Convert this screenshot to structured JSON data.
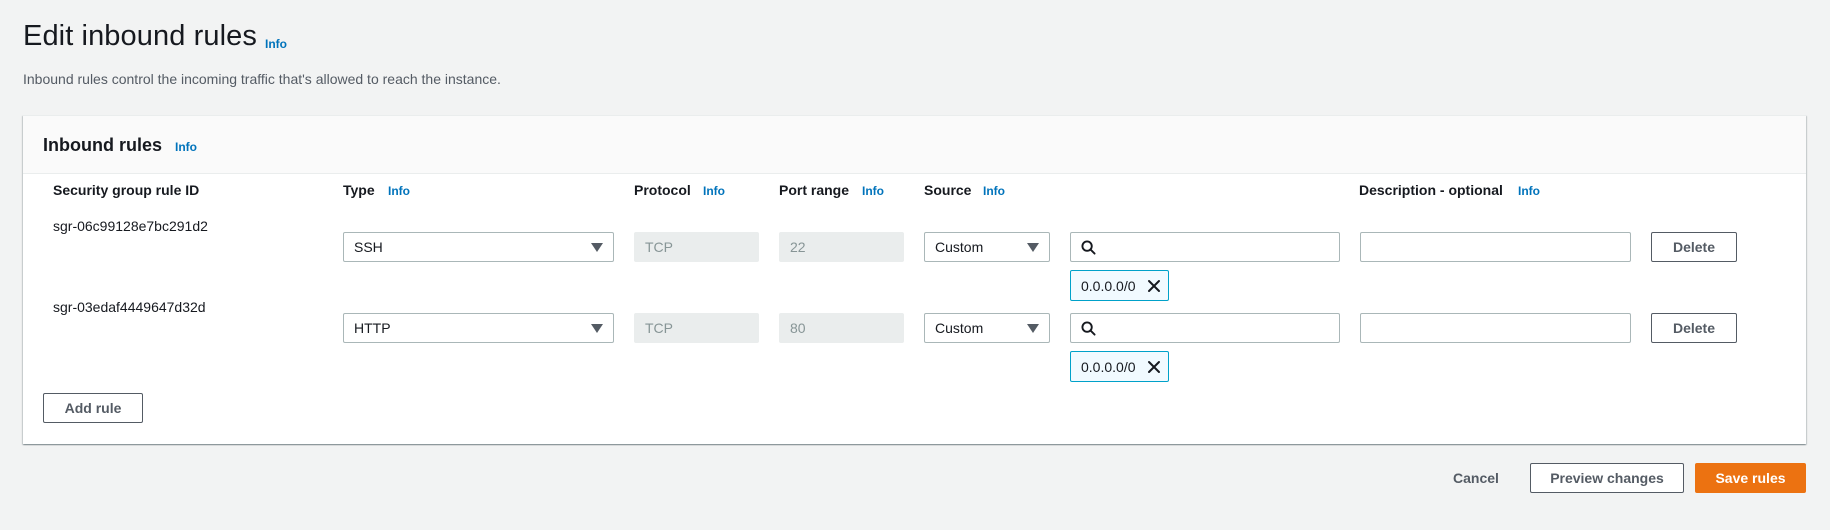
{
  "page": {
    "title": "Edit inbound rules",
    "title_info": "Info",
    "description": "Inbound rules control the incoming traffic that's allowed to reach the instance."
  },
  "panel": {
    "title": "Inbound rules",
    "title_info": "Info",
    "columns": {
      "rule_id": "Security group rule ID",
      "type": "Type",
      "type_info": "Info",
      "protocol": "Protocol",
      "protocol_info": "Info",
      "port_range": "Port range",
      "port_range_info": "Info",
      "source": "Source",
      "source_info": "Info",
      "description": "Description - optional",
      "description_info": "Info"
    },
    "rules": [
      {
        "rule_id": "sgr-06c99128e7bc291d2",
        "type": "SSH",
        "protocol": "TCP",
        "port_range": "22",
        "source": "Custom",
        "search_value": "",
        "token": "0.0.0.0/0",
        "description": "",
        "delete_label": "Delete"
      },
      {
        "rule_id": "sgr-03edaf4449647d32d",
        "type": "HTTP",
        "protocol": "TCP",
        "port_range": "80",
        "source": "Custom",
        "search_value": "",
        "token": "0.0.0.0/0",
        "description": "",
        "delete_label": "Delete"
      }
    ],
    "add_rule_label": "Add rule"
  },
  "footer": {
    "cancel_label": "Cancel",
    "preview_label": "Preview changes",
    "save_label": "Save rules"
  },
  "colors": {
    "primary": "#ec7211",
    "link": "#0073bb",
    "token_border": "#00a1c9"
  },
  "icons": {
    "search": "search-icon",
    "dropdown": "caret-down-icon",
    "remove_token": "close-icon"
  }
}
